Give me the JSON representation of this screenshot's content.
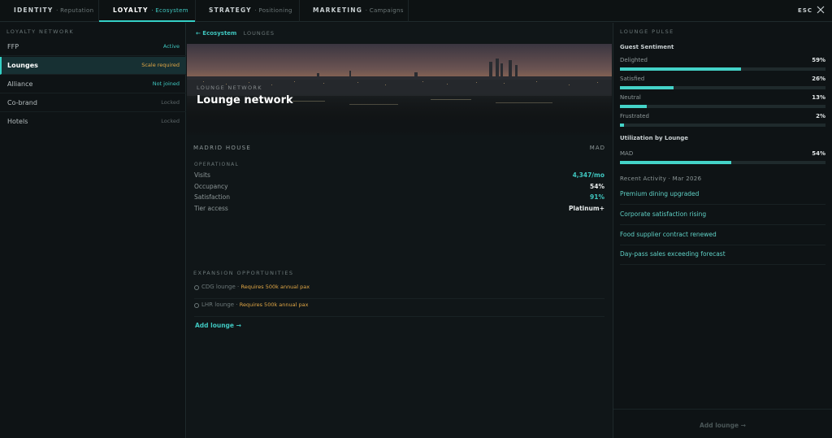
{
  "tabs": [
    {
      "main": "IDENTITY",
      "sub": "· Reputation"
    },
    {
      "main": "LOYALTY",
      "sub": "· Ecosystem"
    },
    {
      "main": "STRATEGY",
      "sub": "· Positioning"
    },
    {
      "main": "MARKETING",
      "sub": "· Campaigns"
    }
  ],
  "esc_label": "ESC",
  "left": {
    "title": "LOYALTY NETWORK",
    "items": [
      {
        "label": "FFP",
        "status": "Active",
        "status_color": "#3fc6bf"
      },
      {
        "label": "Lounges",
        "status": "Scale required",
        "status_color": "#e0a645"
      },
      {
        "label": "Alliance",
        "status": "Not joined",
        "status_color": "#3fc6bf"
      },
      {
        "label": "Co-brand",
        "status": "Locked",
        "status_color": "#5c6668"
      },
      {
        "label": "Hotels",
        "status": "Locked",
        "status_color": "#5c6668"
      }
    ]
  },
  "center": {
    "breadcrumb_back": "← Ecosystem",
    "breadcrumb_current": "LOUNGES",
    "hero_eyebrow": "LOUNGE NETWORK",
    "hero_title": "Lounge network",
    "house_name": "MADRID HOUSE",
    "house_code": "MAD",
    "operational_label": "OPERATIONAL",
    "metrics": [
      {
        "label": "Visits",
        "value": "4,347/mo",
        "color": "#3fc6bf"
      },
      {
        "label": "Occupancy",
        "value": "54%",
        "color": "#e8ecec"
      },
      {
        "label": "Satisfaction",
        "value": "91%",
        "color": "#3fc6bf"
      },
      {
        "label": "Tier access",
        "value": "Platinum+",
        "color": "#e8ecec"
      }
    ],
    "expansion_label": "EXPANSION OPPORTUNITIES",
    "expansion": [
      {
        "name": "CDG lounge",
        "sep": " · ",
        "req": "Requires 500k annual pax"
      },
      {
        "name": "LHR lounge",
        "sep": " · ",
        "req": "Requires 500k annual pax"
      }
    ],
    "add_lounge": "Add lounge →"
  },
  "right": {
    "title": "LOUNGE PULSE",
    "sentiment_label": "Guest Sentiment",
    "sentiment": [
      {
        "label": "Delighted",
        "value": "59%",
        "pct": 59
      },
      {
        "label": "Satisfied",
        "value": "26%",
        "pct": 26
      },
      {
        "label": "Neutral",
        "value": "13%",
        "pct": 13
      },
      {
        "label": "Frustrated",
        "value": "2%",
        "pct": 2
      }
    ],
    "utilization_label": "Utilization by Lounge",
    "utilization": [
      {
        "label": "MAD",
        "value": "54%",
        "pct": 54
      }
    ],
    "recent_label": "Recent Activity · Mar 2026",
    "activity": [
      "Premium dining upgraded",
      "Corporate satisfaction rising",
      "Food supplier contract renewed",
      "Day-pass sales exceeding forecast"
    ],
    "footer_add": "Add lounge →"
  },
  "colors": {
    "accent": "#34d0c6",
    "warning": "#e0a645"
  }
}
